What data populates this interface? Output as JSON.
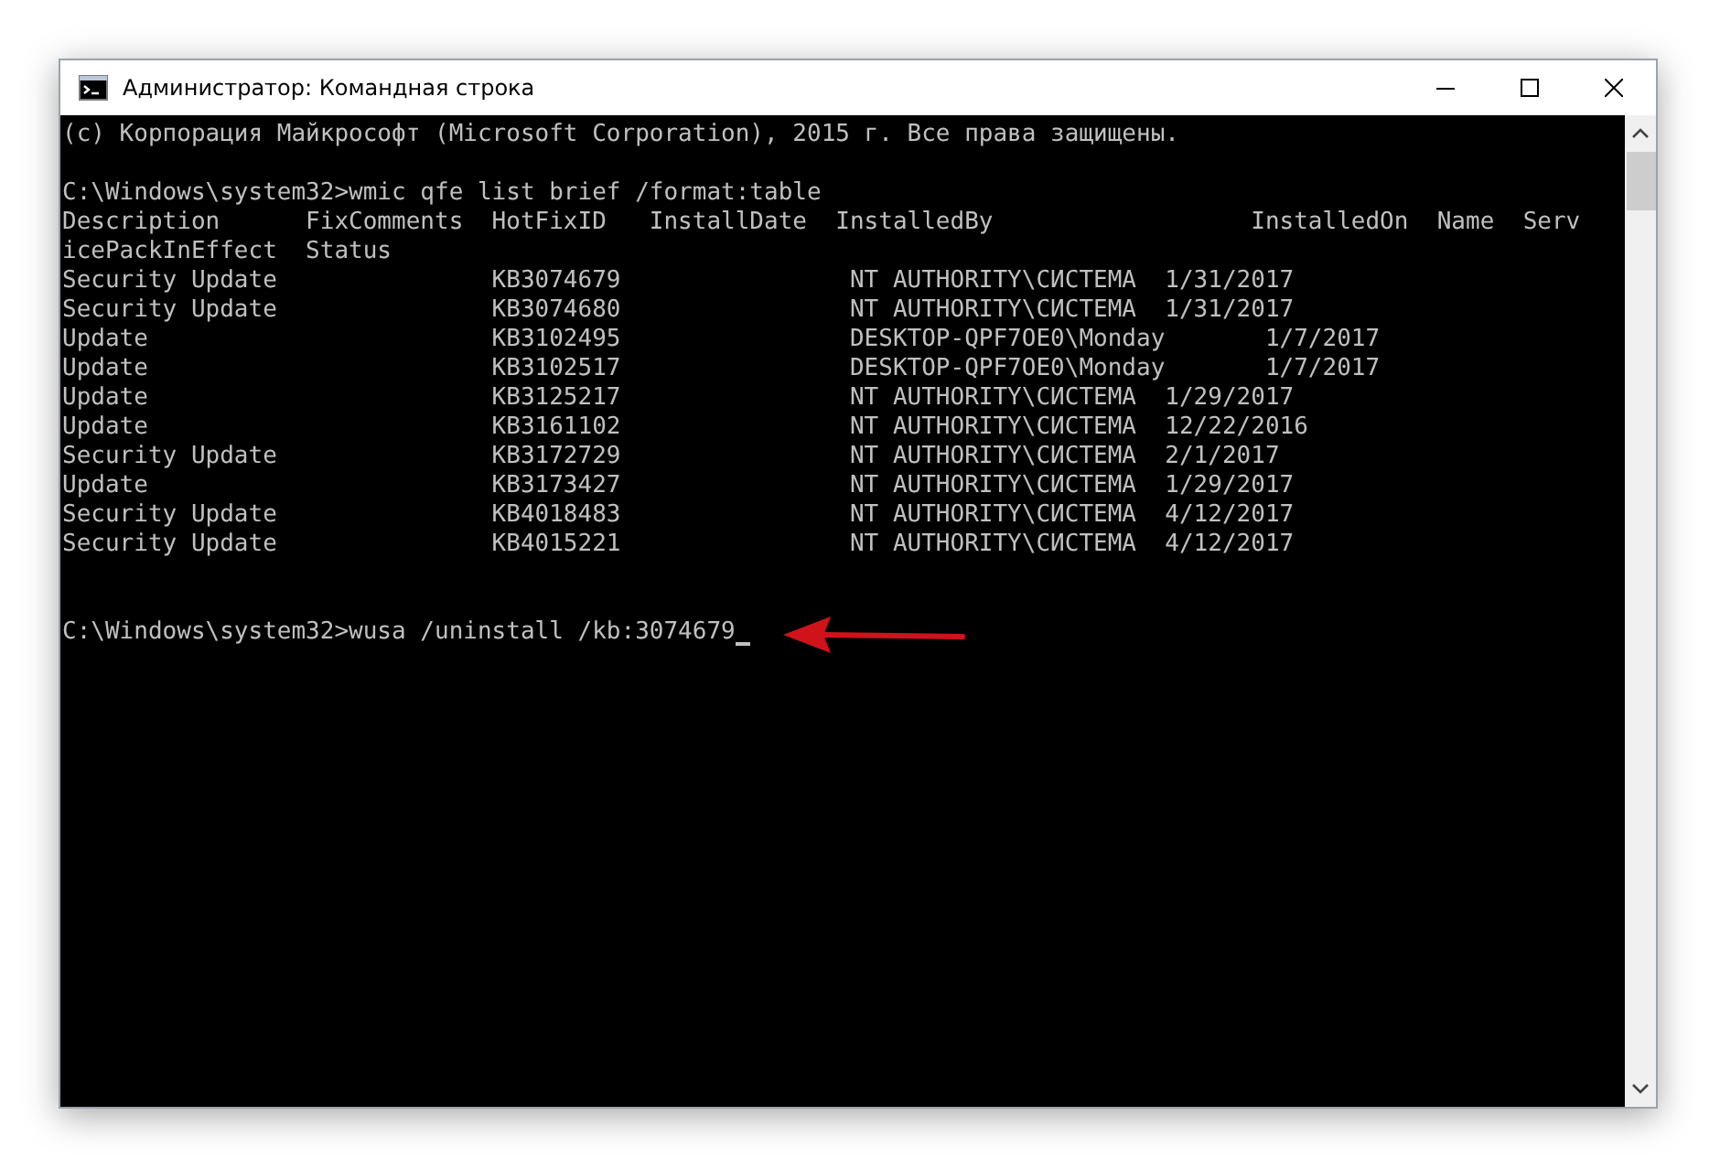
{
  "window": {
    "title": "Администратор: Командная строка"
  },
  "console": {
    "banner": "(c) Корпорация Майкрософт (Microsoft Corporation), 2015 г. Все права защищены.",
    "command": "C:\\Windows\\system32>wmic qfe list brief /format:table",
    "output_lines": [
      "Description      FixComments  HotFixID   InstallDate  InstalledBy                  InstalledOn  Name  Serv",
      "icePackInEffect  Status",
      "Security Update               KB3074679                NT AUTHORITY\\СИСТЕМА  1/31/2017",
      "Security Update               KB3074680                NT AUTHORITY\\СИСТЕМА  1/31/2017",
      "Update                        KB3102495                DESKTOP-QPF7OE0\\Monday       1/7/2017",
      "Update                        KB3102517                DESKTOP-QPF7OE0\\Monday       1/7/2017",
      "Update                        KB3125217                NT AUTHORITY\\СИСТЕМА  1/29/2017",
      "Update                        KB3161102                NT AUTHORITY\\СИСТЕМА  12/22/2016",
      "Security Update               KB3172729                NT AUTHORITY\\СИСТЕМА  2/1/2017",
      "Update                        KB3173427                NT AUTHORITY\\СИСТЕМА  1/29/2017",
      "Security Update               KB4018483                NT AUTHORITY\\СИСТЕМА  4/12/2017",
      "Security Update               KB4015221                NT AUTHORITY\\СИСТЕМА  4/12/2017"
    ],
    "prompt": {
      "text": "C:\\Windows\\system32>wusa /uninstall /kb:3074679",
      "cursor": true
    }
  }
}
